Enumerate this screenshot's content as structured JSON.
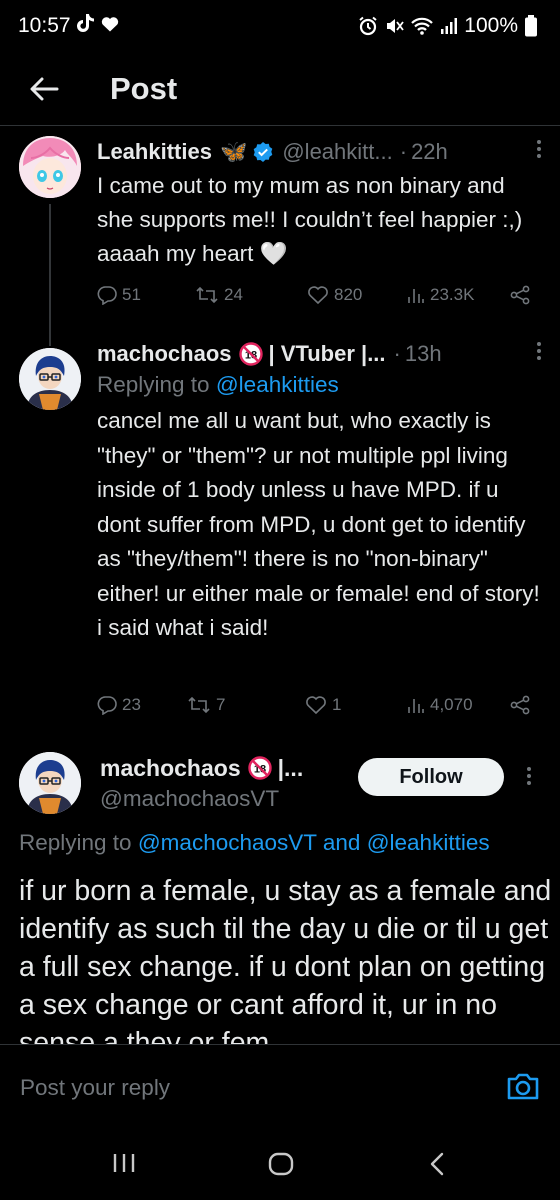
{
  "status_bar": {
    "time": "10:57",
    "battery": "100%"
  },
  "header": {
    "title": "Post"
  },
  "tweet1": {
    "name": "Leahkitties",
    "name_emoji": "🦋",
    "handle": "@leahkitt...",
    "dot": "·",
    "time": "22h",
    "text": "I came out to my mum as non binary and she supports me!! I couldn’t feel happier :,) aaaah my heart 🤍",
    "replies": "51",
    "reposts": "24",
    "likes": "820",
    "views": "23.3K"
  },
  "tweet2": {
    "name": "machochaos",
    "name_suffix": "| VTuber |...",
    "dot": "·",
    "time": "13h",
    "reply_prefix": "Replying to",
    "reply_mention": "@leahkitties",
    "text": "cancel me all u want but, who exactly is \"they\" or \"them\"? ur not multiple ppl living inside of 1 body unless u have MPD. if u dont suffer from MPD, u dont get to identify as \"they/them\"! there is no \"non-binary\" either! ur either male or female! end of story! i said what i said!",
    "replies": "23",
    "reposts": "7",
    "likes": "1",
    "views": "4,070"
  },
  "focused": {
    "name": "machochaos",
    "name_suffix": "|...",
    "handle": "@machochaosVT",
    "follow_label": "Follow",
    "reply_prefix": "Replying to",
    "reply_mention_1": "@machochaosVT",
    "reply_and": "and",
    "reply_mention_2": "@leahkitties",
    "text": "if ur born a female, u stay as a female and identify as such til the day u die or til u get a full sex change. if u dont plan on getting a sex change or cant afford it, ur in no sense a they or fem"
  },
  "reply_bar": {
    "placeholder": "Post your reply"
  },
  "colors": {
    "accent": "#1d9bf0",
    "verified": "#1d9bf0",
    "muted": "#71767b",
    "background": "#000000"
  },
  "icons": [
    "tiktok-icon",
    "heart-icon",
    "alarm-icon",
    "mute-icon",
    "wifi-icon",
    "signal-icon",
    "battery-icon",
    "back-arrow-icon",
    "verified-badge-icon",
    "no-18-icon",
    "reply-icon",
    "repost-icon",
    "like-icon",
    "views-icon",
    "share-icon",
    "more-icon",
    "camera-icon",
    "recents-icon",
    "home-icon",
    "back-nav-icon"
  ]
}
